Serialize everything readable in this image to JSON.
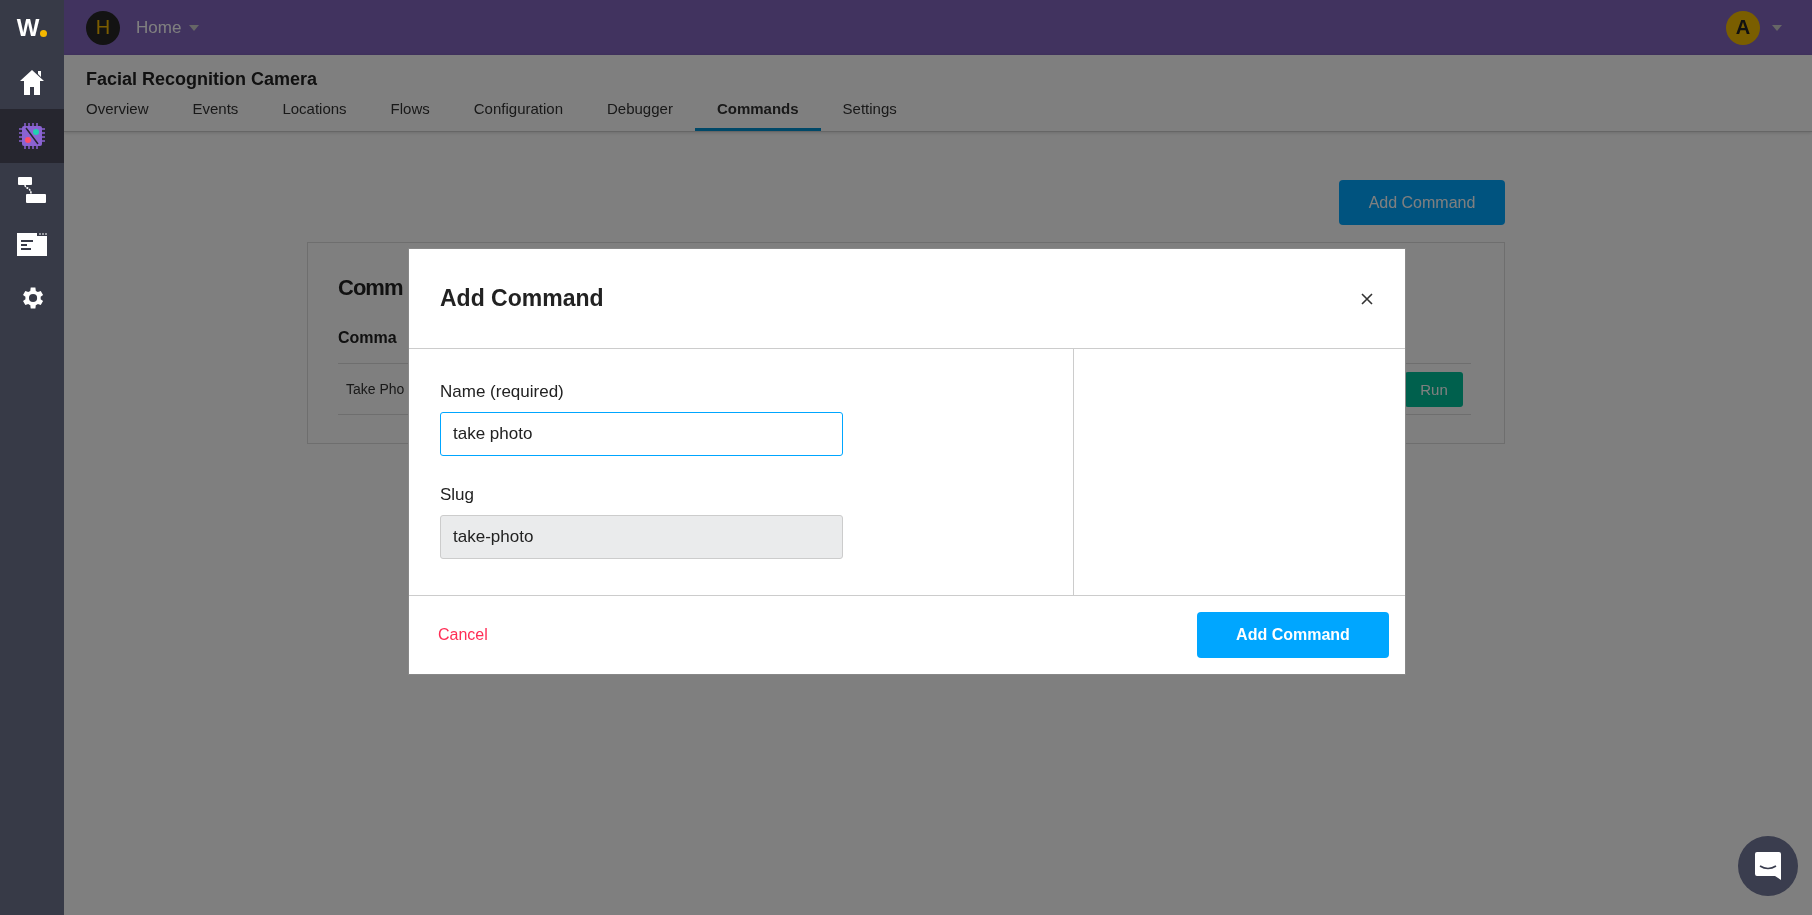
{
  "sidebar": {
    "logo": "W",
    "items": [
      {
        "selected": false
      },
      {
        "selected": true
      },
      {
        "selected": false
      },
      {
        "selected": false
      },
      {
        "selected": false
      }
    ]
  },
  "header": {
    "workspace_initial": "H",
    "workspace_name": "Home",
    "user_initial": "A"
  },
  "device": {
    "title": "Facial Recognition Camera",
    "tabs": [
      {
        "label": "Overview",
        "selected": false
      },
      {
        "label": "Events",
        "selected": false
      },
      {
        "label": "Locations",
        "selected": false
      },
      {
        "label": "Flows",
        "selected": false
      },
      {
        "label": "Configuration",
        "selected": false
      },
      {
        "label": "Debugger",
        "selected": false
      },
      {
        "label": "Commands",
        "selected": true
      },
      {
        "label": "Settings",
        "selected": false
      }
    ]
  },
  "page": {
    "add_button": "Add Command",
    "card": {
      "title": "Comm",
      "section_title": "Comma",
      "rows": [
        {
          "name": "Take Pho",
          "action": "Run"
        }
      ]
    }
  },
  "modal": {
    "title": "Add Command",
    "fields": [
      {
        "label": "Name (required)",
        "value": "take photo",
        "focused": true,
        "disabled": false
      },
      {
        "label": "Slug",
        "value": "take-photo",
        "focused": false,
        "disabled": true
      }
    ],
    "cancel": "Cancel",
    "submit": "Add Command"
  }
}
